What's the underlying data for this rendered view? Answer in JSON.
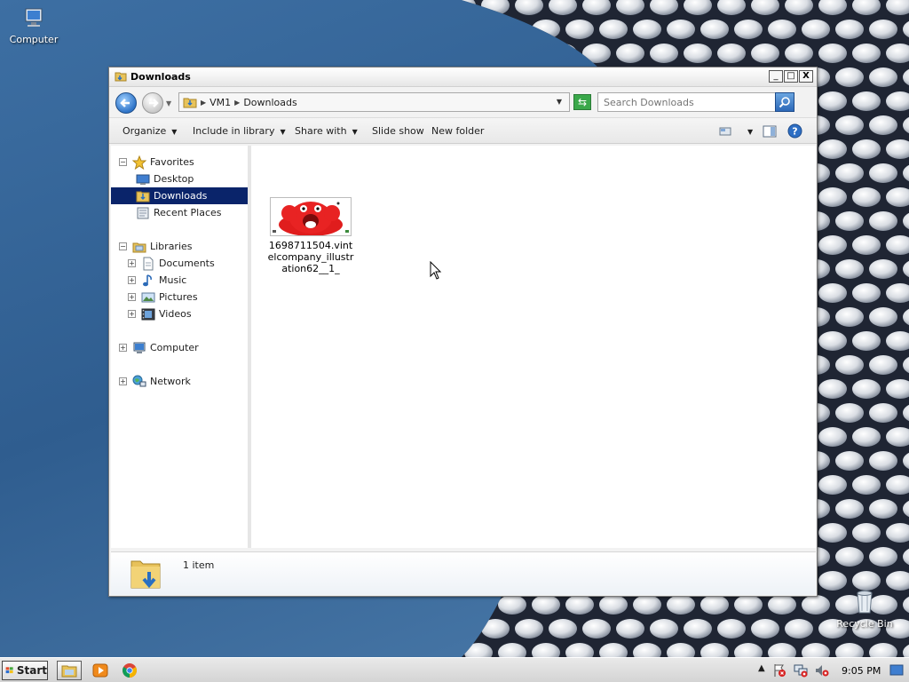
{
  "desktop": {
    "icons": [
      {
        "label": "Computer"
      },
      {
        "label": "Recycle Bin"
      }
    ]
  },
  "window": {
    "title": "Downloads",
    "buttons": {
      "minimize": "_",
      "maximize": "□",
      "close": "X"
    },
    "address": {
      "root": "VM1",
      "current": "Downloads"
    },
    "search": {
      "placeholder": "Search Downloads"
    },
    "toolbar": {
      "organize": "Organize",
      "include_in_library": "Include in library",
      "share_with": "Share with",
      "slide_show": "Slide show",
      "new_folder": "New folder"
    },
    "nav": {
      "favorites": "Favorites",
      "desktop": "Desktop",
      "downloads": "Downloads",
      "recent_places": "Recent Places",
      "libraries": "Libraries",
      "documents": "Documents",
      "music": "Music",
      "pictures": "Pictures",
      "videos": "Videos",
      "computer": "Computer",
      "network": "Network"
    },
    "files": [
      {
        "name": "1698711504.vintelcompany_illustration62__1_"
      }
    ],
    "details": {
      "count": "1 item"
    }
  },
  "taskbar": {
    "start_label": "Start",
    "clock": "9:05 PM"
  },
  "colors": {
    "selection": "#0a246a",
    "wallpaper_sky": "#3d6fa3"
  }
}
